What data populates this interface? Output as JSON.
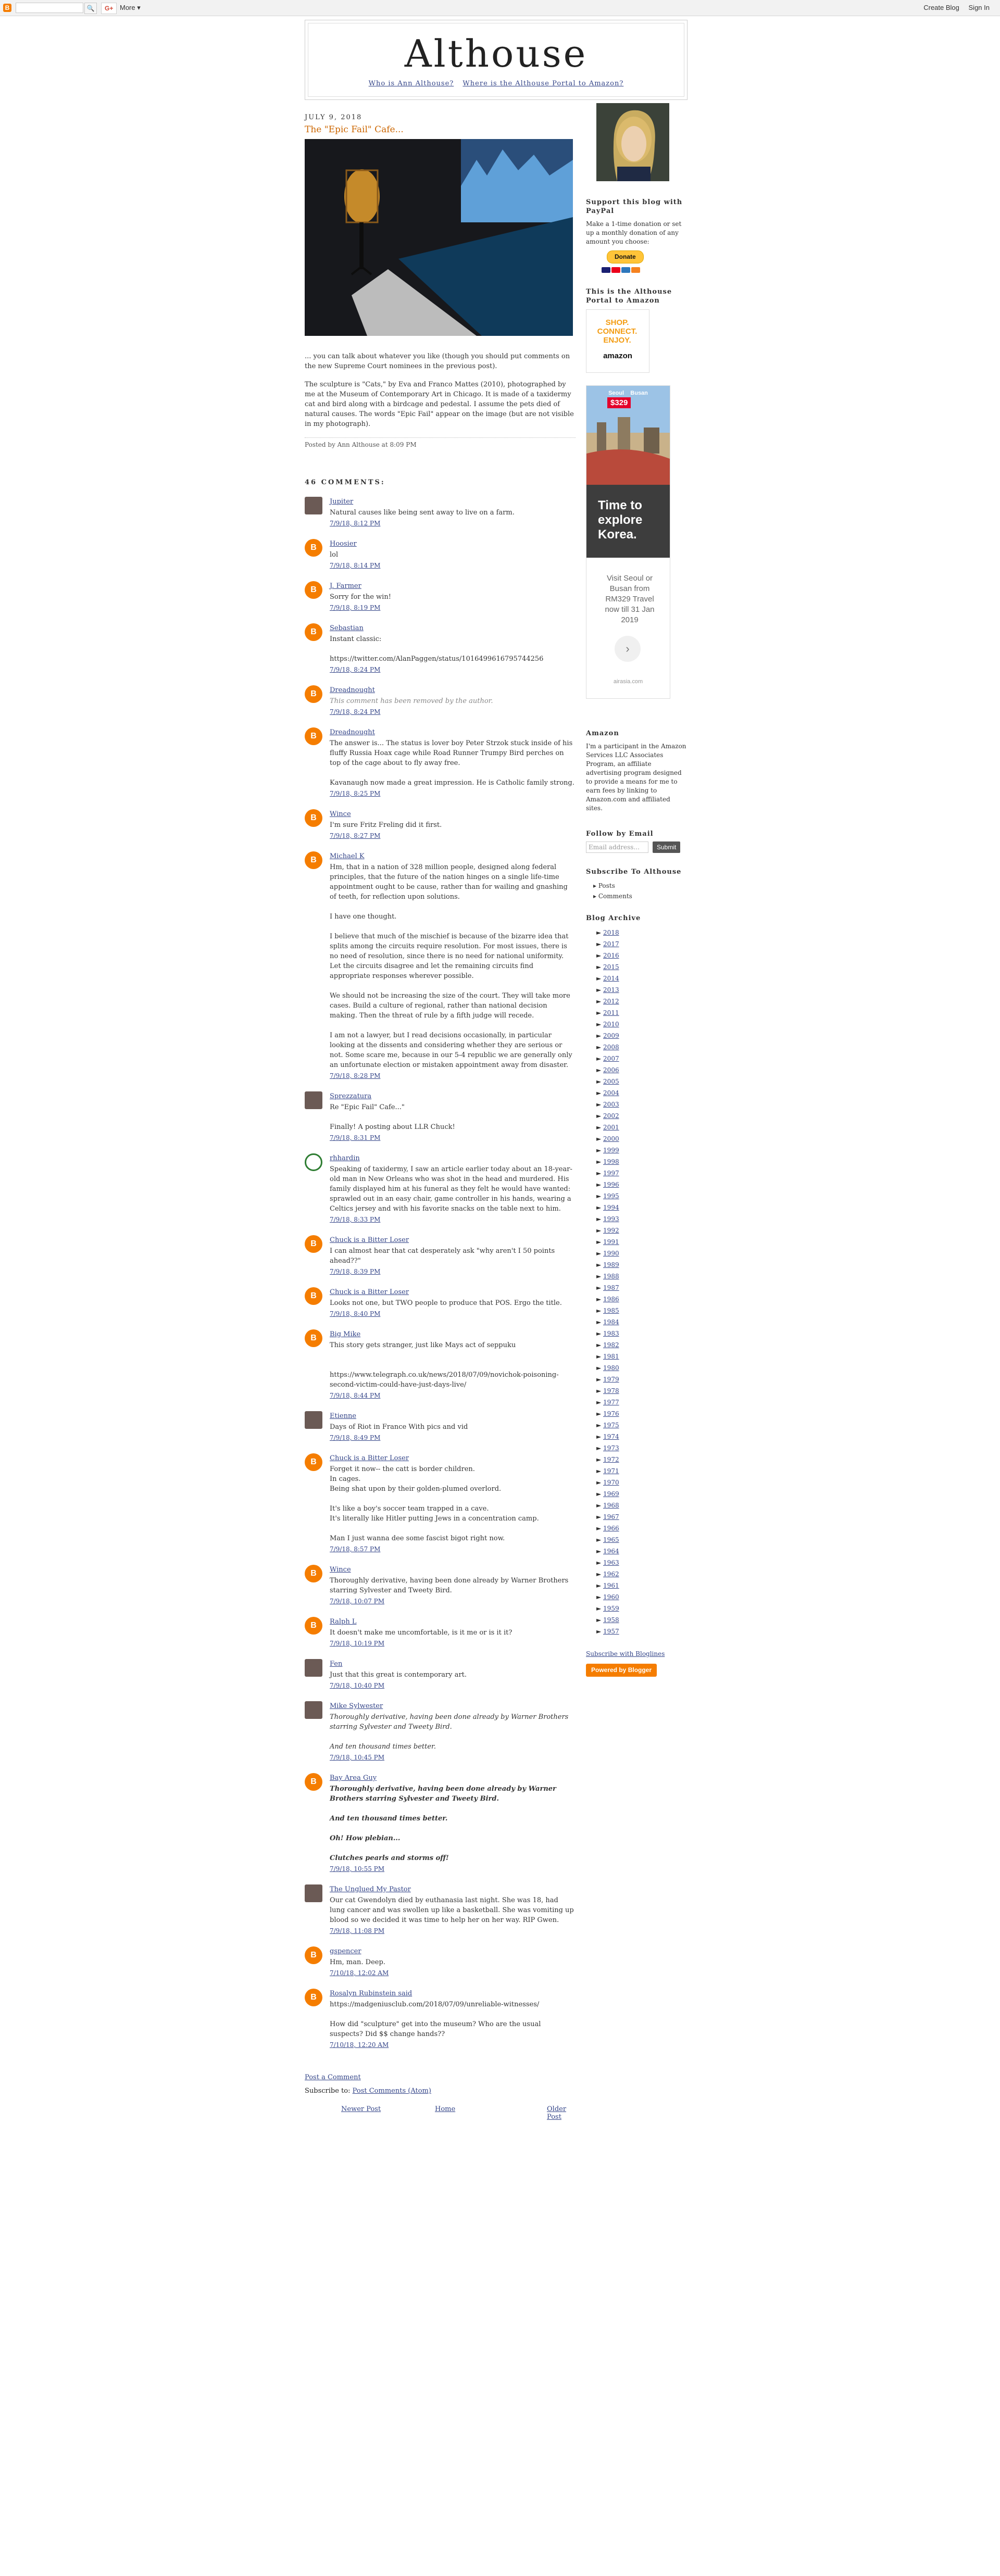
{
  "navbar": {
    "logo": "B",
    "search_button": "🔍",
    "gplus": "G+",
    "more": "More ▾",
    "create_blog": "Create Blog",
    "sign_in": "Sign In"
  },
  "header": {
    "title": "Althouse",
    "links": [
      "Who is Ann Althouse?",
      "Where is the Althouse Portal to Amazon?"
    ]
  },
  "post": {
    "date": "July 9, 2018",
    "title": "The \"Epic Fail\" Cafe...",
    "paragraphs": [
      "... you can talk about whatever you like (though you should put comments on the new Supreme Court nominees in the previous post).",
      "The sculpture is \"Cats,\" by Eva and Franco Mattes (2010), photographed by me at the Museum of Contemporary Art in Chicago. It is made of a taxidermy cat and bird along with a birdcage and pedestal. I assume the pets died of natural causes. The words \"Epic Fail\" appear on the image (but are not visible in my photograph)."
    ],
    "footer": {
      "posted_by": "Posted by Ann Althouse at 8:09 PM",
      "comments_count": "46 comments:"
    }
  },
  "comments": [
    {
      "avatar": "photo",
      "author": "Jupiter",
      "text": "Natural causes like being sent away to live on a farm.",
      "time": "7/9/18, 8:12 PM"
    },
    {
      "avatar": "blogger",
      "author": "Hoosier",
      "text": "lol",
      "time": "7/9/18, 8:14 PM"
    },
    {
      "avatar": "blogger",
      "author": "J. Farmer",
      "text": "Sorry for the win!",
      "time": "7/9/18, 8:19 PM"
    },
    {
      "avatar": "blogger",
      "author": "Sebastian",
      "text": "Instant classic:\n\nhttps://twitter.com/AlanPaggen/status/1016499616795744256",
      "time": "7/9/18, 8:24 PM"
    },
    {
      "avatar": "blogger",
      "author": "Dreadnought",
      "text": "This comment has been removed by the author.",
      "deleted": true,
      "time": "7/9/18, 8:24 PM"
    },
    {
      "avatar": "blogger",
      "author": "Dreadnought",
      "text": "The answer is... The status is lover boy Peter Strzok stuck inside of his fluffy Russia Hoax cage while Road Runner Trumpy Bird perches on top of the cage about to fly away free.\n\nKavanaugh now made a great impression. He is Catholic family strong.",
      "time": "7/9/18, 8:25 PM"
    },
    {
      "avatar": "blogger",
      "author": "Wince",
      "text": "I'm sure Fritz Freling did it first.",
      "time": "7/9/18, 8:27 PM"
    },
    {
      "avatar": "blogger",
      "author": "Michael K",
      "text": "Hm, that in a nation of 328 million people, designed along federal principles, that the future of the nation hinges on a single life-time appointment ought to be cause, rather than for wailing and gnashing of teeth, for reflection upon solutions.\n\nI have one thought.\n\nI believe that much of the mischief is because of the bizarre idea that splits among the circuits require resolution. For most issues, there is no need of resolution, since there is no need for national uniformity. Let the circuits disagree and let the remaining circuits find appropriate responses wherever possible.\n\nWe should not be increasing the size of the court. They will take more cases. Build a culture of regional, rather than national decision making. Then the threat of rule by a fifth judge will recede.\n\nI am not a lawyer, but I read decisions occasionally, in particular looking at the dissents and considering whether they are serious or not. Some scare me, because in our 5-4 republic we are generally only an unfortunate election or mistaken appointment away from disaster.",
      "time": "7/9/18, 8:28 PM"
    },
    {
      "avatar": "photo",
      "author": "Sprezzatura",
      "text": "Re \"Epic Fail\" Cafe...\"\n\nFinally! A posting about LLR Chuck!",
      "time": "7/9/18, 8:31 PM"
    },
    {
      "avatar": "green",
      "author": "rhhardin",
      "text": "Speaking of taxidermy, I saw an article earlier today about an 18-year-old man in New Orleans who was shot in the head and murdered. His family displayed him at his funeral as they felt he would have wanted: sprawled out in an easy chair, game controller in his hands, wearing a Celtics jersey and with his favorite snacks on the table next to him.",
      "time": "7/9/18, 8:33 PM"
    },
    {
      "avatar": "blogger",
      "author": "Chuck is a Bitter Loser",
      "text": "I can almost hear that cat desperately ask \"why aren't I 50 points ahead??\"",
      "time": "7/9/18, 8:39 PM"
    },
    {
      "avatar": "blogger",
      "author": "Chuck is a Bitter Loser",
      "text": "Looks not one, but TWO people to produce that POS. Ergo the title.",
      "time": "7/9/18, 8:40 PM"
    },
    {
      "avatar": "blogger",
      "author": "Big Mike",
      "text": "This story gets stranger, just like Mays act of seppuku\n\n\nhttps://www.telegraph.co.uk/news/2018/07/09/novichok-poisoning-second-victim-could-have-just-days-live/",
      "time": "7/9/18, 8:44 PM"
    },
    {
      "avatar": "photo",
      "author": "Etienne",
      "text": "Days of Riot in France With pics and vid",
      "time": "7/9/18, 8:49 PM"
    },
    {
      "avatar": "blogger",
      "author": "Chuck is a Bitter Loser",
      "text": "Forget it now-- the catt is border children.\nIn cages.\nBeing shat upon by their golden-plumed overlord.\n\nIt's like a boy's soccer team trapped in a cave.\nIt's literally like Hitler putting Jews in a concentration camp.\n\nMan I just wanna dee some fascist bigot right now.",
      "time": "7/9/18, 8:57 PM"
    },
    {
      "avatar": "blogger",
      "author": "Wince",
      "text": "Thoroughly derivative, having been done already by Warner Brothers starring Sylvester and Tweety Bird.",
      "time": "7/9/18, 10:07 PM"
    },
    {
      "avatar": "blogger",
      "author": "Ralph L",
      "text": "It doesn't make me uncomfortable, is it me or is it it?",
      "time": "7/9/18, 10:19 PM"
    },
    {
      "avatar": "photo",
      "author": "Fen",
      "text": "Just that this great is contemporary art.",
      "time": "7/9/18, 10:40 PM"
    },
    {
      "avatar": "photo",
      "author": "Mike Sylwester",
      "text": "Thoroughly derivative, having been done already by Warner Brothers starring Sylvester and Tweety Bird.\n\nAnd ten thousand times better.",
      "italic_first": true,
      "time": "7/9/18, 10:45 PM"
    },
    {
      "avatar": "blogger",
      "author": "Bay Area Guy",
      "text": "Thoroughly derivative, having been done already by Warner Brothers starring Sylvester and Tweety Bird.\n\nAnd ten thousand times better.\n\nOh! How plebian...\n\nClutches pearls and storms off!",
      "bold_first": true,
      "time": "7/9/18, 10:55 PM"
    },
    {
      "avatar": "photo",
      "author": "The Unglued My Pastor",
      "text": "Our cat Gwendolyn died by euthanasia last night. She was 18, had lung cancer and was swollen up like a basketball. She was vomiting up blood so we decided it was time to help her on her way. RIP Gwen.",
      "time": "7/9/18, 11:08 PM"
    },
    {
      "avatar": "blogger",
      "author": "gspencer",
      "text": "Hm, man. Deep.",
      "time": "7/10/18, 12:02 AM"
    },
    {
      "avatar": "blogger",
      "author": "Rosalyn Rubinstein said",
      "text": "https://madgeniusclub.com/2018/07/09/unreliable-witnesses/\n\nHow did \"sculpture\" get into the museum? Who are the usual suspects? Did $$ change hands??",
      "time": "7/10/18, 12:20 AM"
    }
  ],
  "comments_footer": {
    "post_comment": "Post a Comment",
    "subscribe_label": "Subscribe to:",
    "subscribe_link": "Post Comments (Atom)"
  },
  "pager": {
    "newer": "Newer Post",
    "home": "Home",
    "older": "Older Post"
  },
  "sidebar": {
    "support_title": "Support this blog with PayPal",
    "support_text": "Make a 1-time donation or set up a monthly donation of any amount you choose:",
    "donate": "Donate",
    "portal_text": "This is the Althouse Portal to Amazon",
    "amazon_ad": {
      "line1": "SHOP.",
      "line2": "CONNECT.",
      "line3": "ENJOY.",
      "brand": "amazon"
    },
    "travel_ad": {
      "city1": "Seoul",
      "city2": "Busan",
      "price": "$329",
      "headline1": "Time to",
      "headline2": "explore",
      "headline3": "Korea.",
      "body": "Visit Seoul or Busan from RM329 Travel now till 31 Jan 2019",
      "site": "airasia.com"
    },
    "amazon_title": "Amazon",
    "amazon_text": "I'm a participant in the Amazon Services LLC Associates Program, an affiliate advertising program designed to provide a means for me to earn fees by linking to Amazon.com and affiliated sites.",
    "email_title": "Follow by Email",
    "email_placeholder": "Email address...",
    "email_submit": "Submit",
    "subscribe_title": "Subscribe To Althouse",
    "archive_title": "Blog Archive",
    "archive": [
      "2018",
      "2017",
      "2016",
      "2015",
      "2014",
      "2013",
      "2012",
      "2011",
      "2010",
      "2009",
      "2008",
      "2007",
      "2006",
      "2005",
      "2004",
      "2003",
      "2002",
      "2001",
      "2000",
      "1999",
      "1998",
      "1997",
      "1996",
      "1995",
      "1994",
      "1993",
      "1992",
      "1991",
      "1990",
      "1989",
      "1988",
      "1987",
      "1986",
      "1985",
      "1984",
      "1983",
      "1982",
      "1981",
      "1980",
      "1979",
      "1978",
      "1977",
      "1976",
      "1975",
      "1974",
      "1973",
      "1972",
      "1971",
      "1970",
      "1969",
      "1968",
      "1967",
      "1966",
      "1965",
      "1964",
      "1963",
      "1962",
      "1961",
      "1960",
      "1959",
      "1958",
      "1957"
    ],
    "bloglines": "Subscribe with Bloglines",
    "powered_by": "Powered by Blogger"
  }
}
